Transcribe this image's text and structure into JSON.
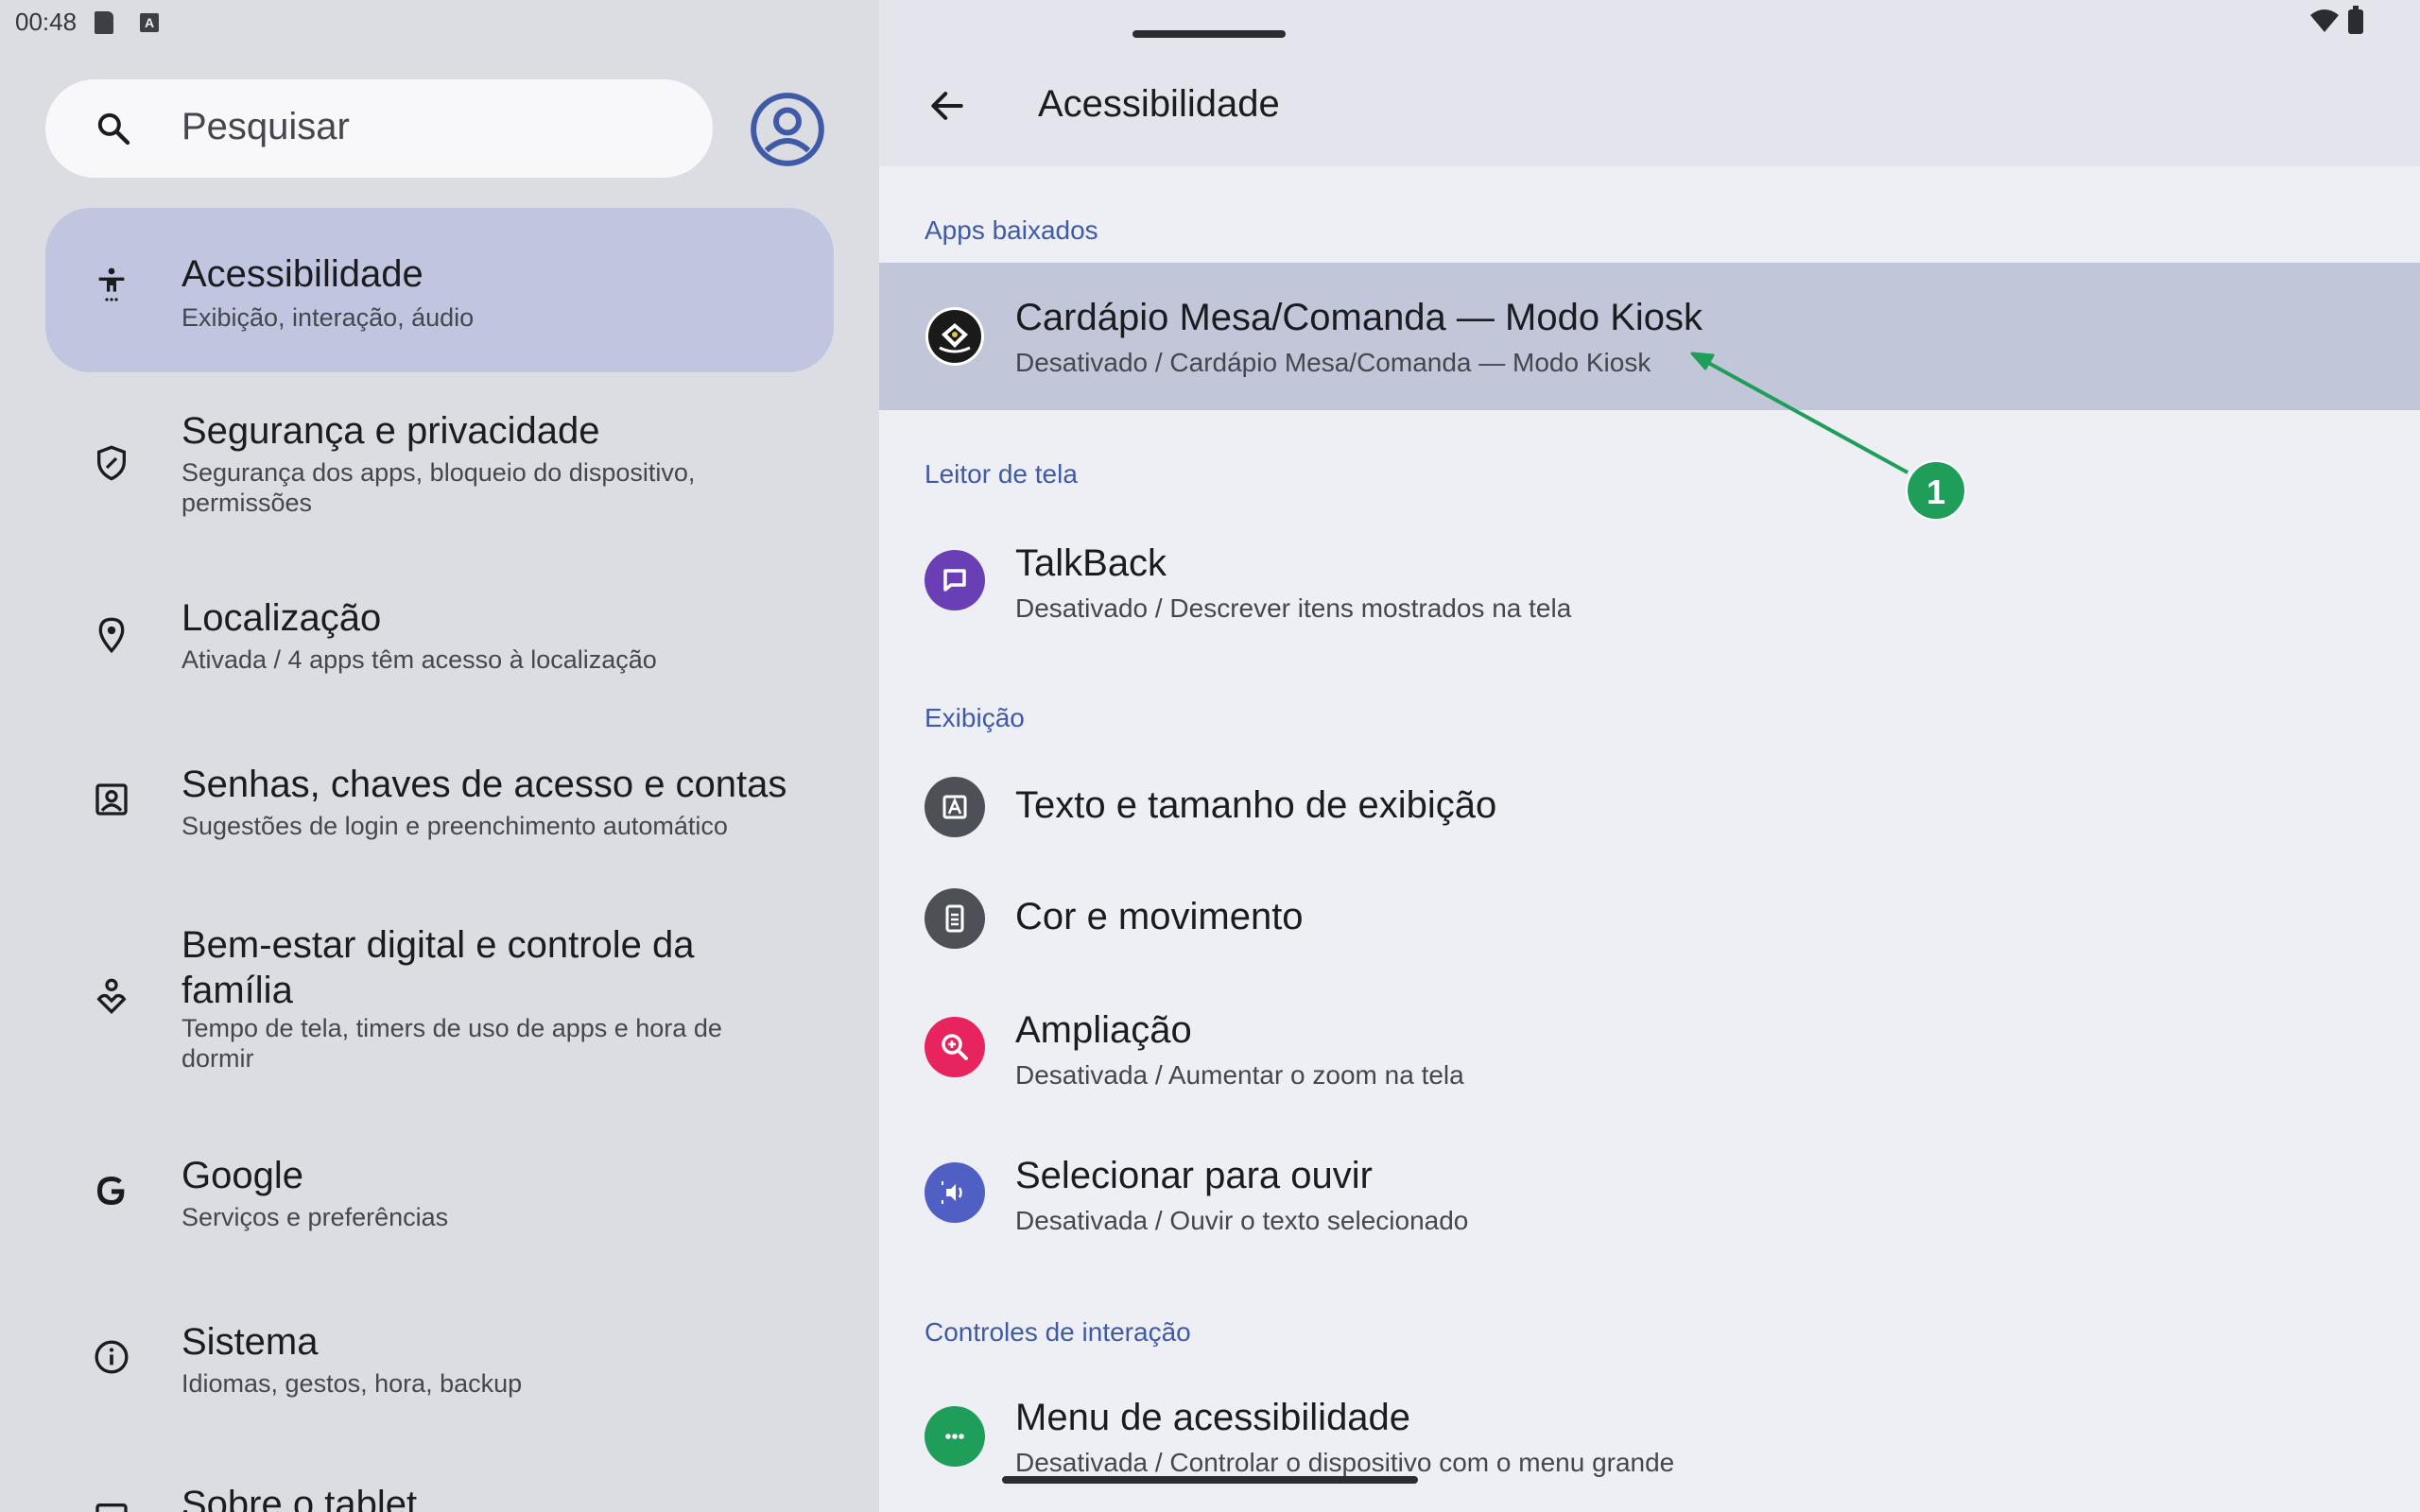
{
  "status": {
    "time": "00:48",
    "a_badge": "A"
  },
  "search": {
    "placeholder": "Pesquisar"
  },
  "sidebar": {
    "items": [
      {
        "title": "Acessibilidade",
        "subtitle": "Exibição, interação, áudio",
        "icon": "accessibility-icon"
      },
      {
        "title": "Segurança e privacidade",
        "subtitle": "Segurança dos apps, bloqueio do dispositivo, permissões",
        "icon": "shield-icon"
      },
      {
        "title": "Localização",
        "subtitle": "Ativada / 4 apps têm acesso à localização",
        "icon": "location-pin-icon"
      },
      {
        "title": "Senhas, chaves de acesso e contas",
        "subtitle": "Sugestões de login e preenchimento automático",
        "icon": "account-box-icon"
      },
      {
        "title": "Bem-estar digital e controle da família",
        "subtitle": "Tempo de tela, timers de uso de apps e hora de dormir",
        "icon": "wellbeing-icon"
      },
      {
        "title": "Google",
        "subtitle": "Serviços e preferências",
        "icon": "google-icon"
      },
      {
        "title": "Sistema",
        "subtitle": "Idiomas, gestos, hora, backup",
        "icon": "info-icon"
      },
      {
        "title": "Sobre o tablet",
        "subtitle": "",
        "icon": "tablet-icon"
      }
    ]
  },
  "main": {
    "title": "Acessibilidade",
    "sections": {
      "downloaded": "Apps baixados",
      "screen_reader": "Leitor de tela",
      "display": "Exibição",
      "interaction": "Controles de interação"
    },
    "rows": {
      "kiosk": {
        "title": "Cardápio Mesa/Comanda — Modo Kiosk",
        "subtitle": "Desativado / Cardápio Mesa/Comanda — Modo Kiosk"
      },
      "talkback": {
        "title": "TalkBack",
        "subtitle": "Desativado / Descrever itens mostrados na tela"
      },
      "text_size": {
        "title": "Texto e tamanho de exibição"
      },
      "color_motion": {
        "title": "Cor e movimento"
      },
      "magnification": {
        "title": "Ampliação",
        "subtitle": "Desativada / Aumentar o zoom na tela"
      },
      "select_to_speak": {
        "title": "Selecionar para ouvir",
        "subtitle": "Desativada / Ouvir o texto selecionado"
      },
      "a11y_menu": {
        "title": "Menu de acessibilidade",
        "subtitle": "Desativada / Controlar o dispositivo com o menu grande"
      }
    }
  },
  "annotation": {
    "label": "1"
  },
  "colors": {
    "accent": "#3f5aa6",
    "selected_nav": "#c1c6e0",
    "highlight_row": "#c1c6d8",
    "talkback": "#6a3fb5",
    "magnification": "#e8245f",
    "select_to_speak": "#4f5fc4",
    "a11y_menu": "#1e9e59",
    "annotation": "#1e9e59"
  }
}
